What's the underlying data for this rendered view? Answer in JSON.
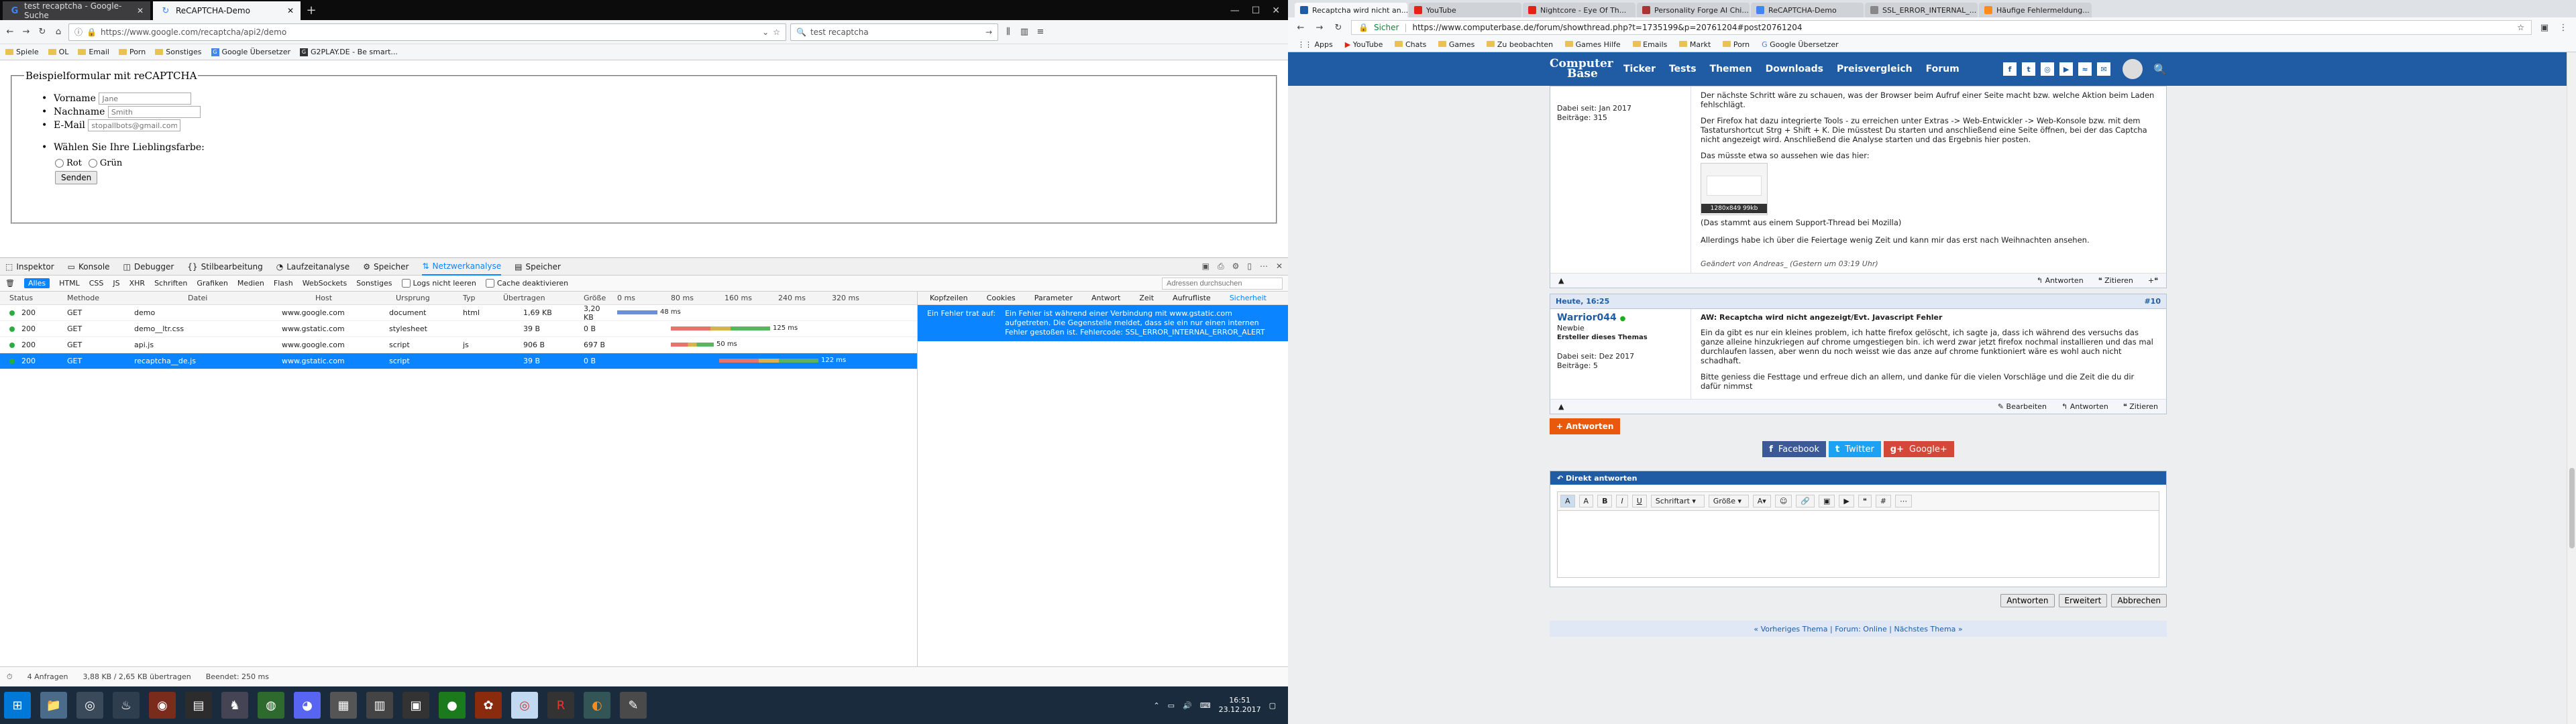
{
  "left": {
    "tabs": [
      {
        "label": "test recaptcha - Google-Suche",
        "active": false
      },
      {
        "label": "ReCAPTCHA-Demo",
        "active": true
      }
    ],
    "url": "https://www.google.com/recaptcha/api2/demo",
    "search_value": "test recaptcha",
    "bookmarks": [
      "Spiele",
      "OL",
      "Email",
      "Porn",
      "Sonstiges",
      "Google Übersetzer",
      "G2PLAY.DE - Be smart..."
    ],
    "form": {
      "legend": "Beispielformular mit reCAPTCHA",
      "fields": [
        {
          "label": "Vorname",
          "placeholder": "Jane"
        },
        {
          "label": "Nachname",
          "placeholder": "Smith"
        },
        {
          "label": "E-Mail",
          "placeholder": "stopallbots@gmail.com"
        }
      ],
      "color_question": "Wählen Sie Ihre Lieblingsfarbe:",
      "colors": [
        "Rot",
        "Grün"
      ],
      "submit": "Senden"
    },
    "devtools": {
      "tools": [
        "Inspektor",
        "Konsole",
        "Debugger",
        "Stilbearbeitung",
        "Laufzeitanalyse",
        "Speicher",
        "Netzwerkanalyse",
        "Speicher"
      ],
      "active_tool": "Netzwerkanalyse",
      "filters": [
        "Alles",
        "HTML",
        "CSS",
        "JS",
        "XHR",
        "Schriften",
        "Grafiken",
        "Medien",
        "Flash",
        "WebSockets",
        "Sonstiges"
      ],
      "log_option": "Logs nicht leeren",
      "cache_option": "Cache deaktivieren",
      "filter_placeholder": "Adressen durchsuchen",
      "columns": [
        "Status",
        "Methode",
        "Datei",
        "Host",
        "Ursprung",
        "Typ",
        "Übertragen",
        "Größe",
        "0 ms",
        "80 ms",
        "160 ms",
        "240 ms",
        "320 ms"
      ],
      "rows": [
        {
          "status": "200",
          "method": "GET",
          "file": "demo",
          "host": "www.google.com",
          "cause": "document",
          "type": "html",
          "transferred": "1,69 KB",
          "size": "3,20 KB",
          "time": "48 ms",
          "bar_start": 0.0,
          "bar_len": 0.15,
          "selected": false
        },
        {
          "status": "200",
          "method": "GET",
          "file": "demo__ltr.css",
          "host": "www.gstatic.com",
          "cause": "stylesheet",
          "type": "",
          "transferred": "39 B",
          "size": "0 B",
          "time": "125 ms",
          "bar_start": 0.2,
          "bar_len": 0.37,
          "selected": false
        },
        {
          "status": "200",
          "method": "GET",
          "file": "api.js",
          "host": "www.google.com",
          "cause": "script",
          "type": "js",
          "transferred": "906 B",
          "size": "697 B",
          "time": "50 ms",
          "bar_start": 0.2,
          "bar_len": 0.16,
          "selected": false
        },
        {
          "status": "200",
          "method": "GET",
          "file": "recaptcha__de.js",
          "host": "www.gstatic.com",
          "cause": "script",
          "type": "",
          "transferred": "39 B",
          "size": "0 B",
          "time": "122 ms",
          "bar_start": 0.38,
          "bar_len": 0.37,
          "selected": true
        }
      ],
      "side_tabs": [
        "Kopfzeilen",
        "Cookies",
        "Parameter",
        "Antwort",
        "Zeit",
        "Aufrufliste",
        "Sicherheit"
      ],
      "error_label": "Ein Fehler trat auf:",
      "error_text": "Ein Fehler ist während einer Verbindung mit www.gstatic.com aufgetreten. Die Gegenstelle meldet, dass sie ein nur einen internen Fehler gestoßen ist. Fehlercode: SSL_ERROR_INTERNAL_ERROR_ALERT",
      "status_requests": "4 Anfragen",
      "status_transferred": "3,88 KB / 2,65 KB übertragen",
      "status_finished": "Beendet: 250 ms"
    },
    "clock_time": "16:51",
    "clock_date": "23.12.2017"
  },
  "right": {
    "tabs": [
      "Recaptcha wird nicht an...",
      "YouTube",
      "Nightcore - Eye Of Th...",
      "Personality Forge AI Chi...",
      "ReCAPTCHA-Demo",
      "SSL_ERROR_INTERNAL_...",
      "Häufige Fehlermeldung..."
    ],
    "url_secure": "Sicher",
    "url": "https://www.computerbase.de/forum/showthread.php?t=1735199&p=20761204#post20761204",
    "bookmarks": [
      "Apps",
      "YouTube",
      "Chats",
      "Games",
      "Zu beobachten",
      "Games Hilfe",
      "Emails",
      "Markt",
      "Porn",
      "Google Übersetzer"
    ],
    "site_logo_1": "Computer",
    "site_logo_2": "Base",
    "nav": [
      "Ticker",
      "Tests",
      "Themen",
      "Downloads",
      "Preisvergleich",
      "Forum"
    ],
    "post1": {
      "side_since": "Dabei seit: Jan 2017",
      "side_posts": "Beiträge: 315",
      "p1": "Der nächste Schritt wäre zu schauen, was der Browser beim Aufruf einer Seite macht bzw. welche Aktion beim Laden fehlschlägt.",
      "p2": "Der Firefox hat dazu integrierte Tools - zu erreichen unter Extras -> Web-Entwickler -> Web-Konsole bzw. mit dem Tastaturshortcut Strg + Shift + K. Die müsstest Du starten und anschließend eine Seite öffnen, bei der das Captcha nicht angezeigt wird. Anschließend die Analyse starten und das Ergebnis hier posten.",
      "p3": "Das müsste etwa so aussehen wie das hier:",
      "thumb_caption": "1280x849 99kb",
      "p4": "(Das stammt aus einem Support-Thread bei Mozilla)",
      "p5": "Allerdings habe ich über die Feiertage wenig Zeit und kann mir das erst nach Weihnachten ansehen.",
      "edited": "Geändert von Andreas_ (Gestern um 03:19 Uhr)",
      "reply": "Antworten",
      "quote": "Zitieren"
    },
    "post2": {
      "date": "Heute, 16:25",
      "number": "#10",
      "user": "Warrior044",
      "rank": "Newbie",
      "role": "Ersteller dieses Themas",
      "since": "Dabei seit: Dez 2017",
      "posts": "Beiträge: 5",
      "title": "AW: Recaptcha wird nicht angezeigt/Evt. Javascript Fehler",
      "p1": "Ein da gibt es nur ein kleines problem, ich hatte firefox gelöscht, ich sagte ja, dass ich während des versuchs das ganze alleine hinzukriegen auf chrome umgestiegen bin. ich werd zwar jetzt firefox nochmal installieren und das mal durchlaufen lassen, aber wenn du noch weisst wie das anze auf chrome funktioniert wäre es wohl auch nicht schadhaft.",
      "p2": "Bitte geniess die Festtage und erfreue dich an allem, und danke für die vielen Vorschläge und die Zeit die du dir dafür nimmst",
      "edit": "Bearbeiten",
      "reply": "Antworten",
      "quote": "Zitieren"
    },
    "answer_button": "+ Antworten",
    "share": [
      "Facebook",
      "Twitter",
      "Google+"
    ],
    "quick_reply_title": "Direkt antworten",
    "font_select": "Schriftart",
    "size_select": "Größe",
    "buttons": [
      "Antworten",
      "Erweitert",
      "Abbrechen"
    ],
    "thread_nav": "« Vorheriges Thema | Forum: Online | Nächstes Thema »",
    "colors": {
      "brand": "#1f5ca4",
      "answer": "#e8590c",
      "facebook": "#3b5998",
      "twitter": "#1da1f2",
      "google": "#d34836"
    }
  }
}
